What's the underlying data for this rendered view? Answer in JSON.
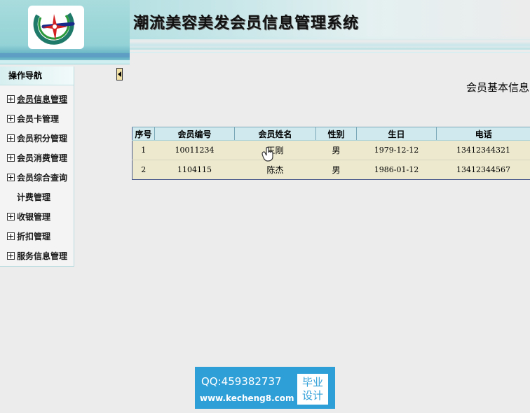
{
  "header": {
    "title": "潮流美容美发会员信息管理系统"
  },
  "sidebar": {
    "title": "操作导航",
    "items": [
      {
        "label": "会员信息管理"
      },
      {
        "label": "会员卡管理"
      },
      {
        "label": "会员积分管理"
      },
      {
        "label": "会员消费管理"
      },
      {
        "label": "会员综合查询"
      },
      {
        "label": "计费管理"
      },
      {
        "label": "收银管理"
      },
      {
        "label": "折扣管理"
      },
      {
        "label": "服务信息管理"
      }
    ]
  },
  "main": {
    "section_title": "会员基本信息",
    "table": {
      "columns": [
        "序号",
        "会员编号",
        "会员姓名",
        "性别",
        "生日",
        "电话"
      ],
      "rows": [
        [
          "1",
          "10011234",
          "王刚",
          "男",
          "1979-12-12",
          "13412344321"
        ],
        [
          "2",
          "1104115",
          "陈杰",
          "男",
          "1986-01-12",
          "13412344567"
        ]
      ]
    }
  },
  "watermark": {
    "qq": "QQ:459382737",
    "url": "www.kecheng8.com",
    "badge_line1": "毕业",
    "badge_line2": "设计"
  },
  "colors": {
    "header_teal": "#93d2d6",
    "table_header": "#cfe9ee",
    "table_row": "#ece9ce",
    "watermark_blue": "#2f9fd8"
  },
  "icons": {
    "logo": "compass-star-logo",
    "expand": "plus-box-icon",
    "collapse": "left-arrow-icon",
    "cursor": "hand-cursor-icon"
  }
}
